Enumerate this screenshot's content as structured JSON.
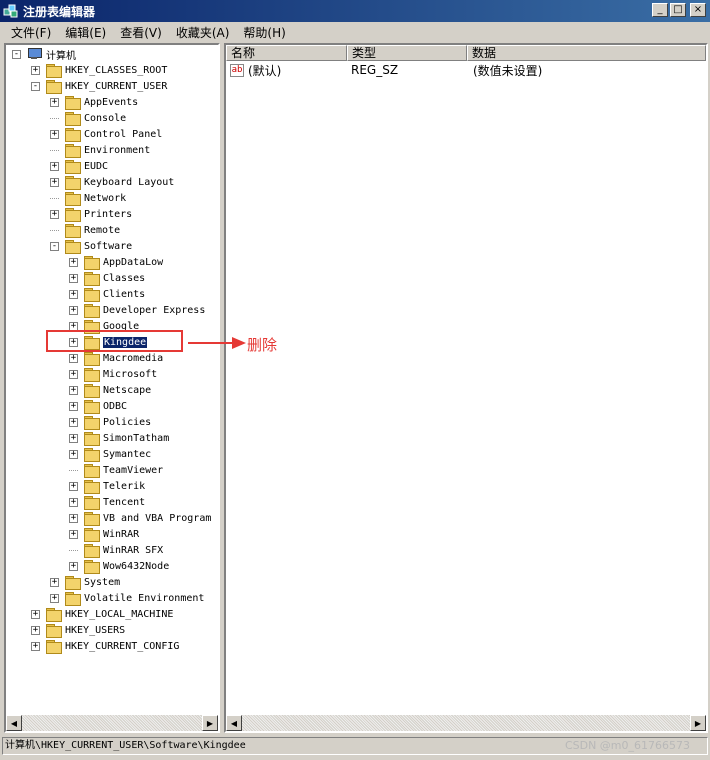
{
  "window": {
    "title": "注册表编辑器",
    "minimize": "_",
    "maximize": "□",
    "close": "×"
  },
  "menu": [
    "文件(F)",
    "编辑(E)",
    "查看(V)",
    "收藏夹(A)",
    "帮助(H)"
  ],
  "tree": {
    "root": "计算机",
    "hives": [
      "HKEY_CLASSES_ROOT",
      "HKEY_CURRENT_USER",
      "HKEY_LOCAL_MACHINE",
      "HKEY_USERS",
      "HKEY_CURRENT_CONFIG"
    ],
    "current_user_children": [
      "AppEvents",
      "Console",
      "Control Panel",
      "Environment",
      "EUDC",
      "Keyboard Layout",
      "Network",
      "Printers",
      "Remote",
      "Software",
      "System",
      "Volatile Environment"
    ],
    "software_children": [
      "AppDataLow",
      "Classes",
      "Clients",
      "Developer Express",
      "Google",
      "Kingdee",
      "Macromedia",
      "Microsoft",
      "Netscape",
      "ODBC",
      "Policies",
      "SimonTatham",
      "Symantec",
      "TeamViewer",
      "Telerik",
      "Tencent",
      "VB and VBA Program",
      "WinRAR",
      "WinRAR SFX",
      "Wow6432Node"
    ],
    "selected": "Kingdee"
  },
  "list": {
    "columns": [
      "名称",
      "类型",
      "数据"
    ],
    "rows": [
      {
        "name": "(默认)",
        "type": "REG_SZ",
        "data": "(数值未设置)"
      }
    ]
  },
  "status": "计算机\\HKEY_CURRENT_USER\\Software\\Kingdee",
  "watermark": "CSDN @m0_61766573",
  "annotation": {
    "text": "删除",
    "color": "#e53935"
  }
}
